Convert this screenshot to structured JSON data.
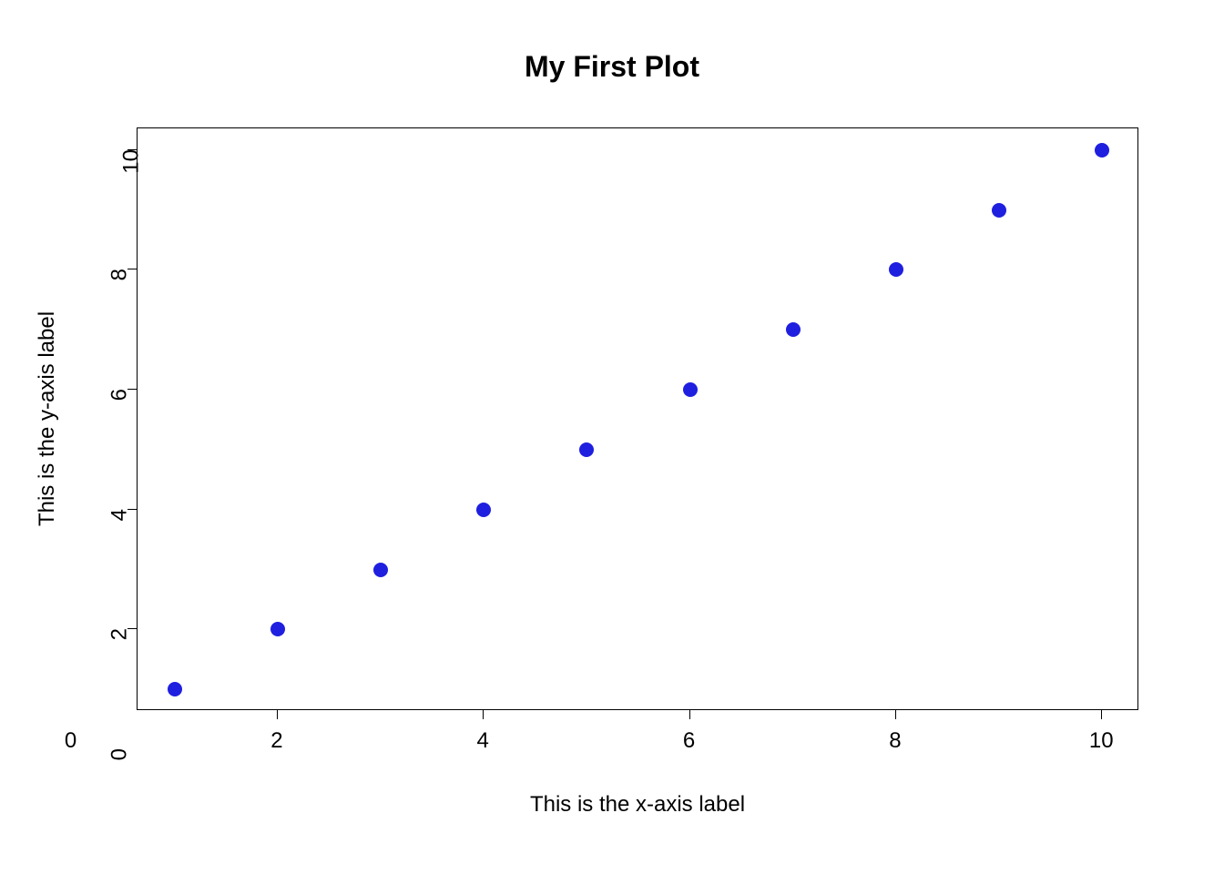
{
  "chart_data": {
    "type": "scatter",
    "title": "My First Plot",
    "xlabel": "This is the x-axis label",
    "ylabel": "This is the y-axis label",
    "xlim": [
      0,
      11
    ],
    "ylim": [
      0,
      11
    ],
    "xticks": [
      0,
      2,
      4,
      6,
      8,
      10
    ],
    "yticks": [
      0,
      2,
      4,
      6,
      8,
      10
    ],
    "point_color": "#1f1fe0",
    "x": [
      1,
      2,
      3,
      4,
      5,
      6,
      7,
      8,
      9,
      10
    ],
    "y": [
      1,
      2,
      3,
      4,
      5,
      6,
      7,
      8,
      9,
      10
    ]
  }
}
